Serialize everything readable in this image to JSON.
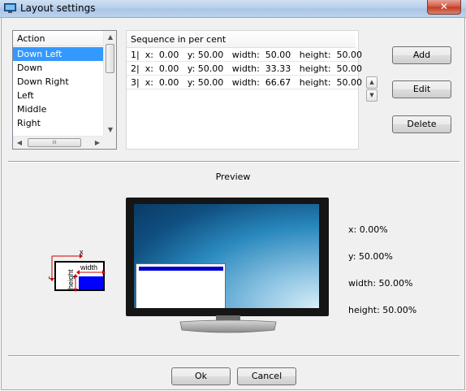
{
  "window": {
    "title": "Layout settings",
    "close_label": "✕"
  },
  "action_list": {
    "header": "Action",
    "items": [
      "Down Left",
      "Down",
      "Down Right",
      "Left",
      "Middle",
      "Right"
    ],
    "selected_index": 0,
    "hscroll_grip": "III"
  },
  "sequence": {
    "header": "Sequence in per cent",
    "rows": [
      "1|  x:  0.00   y: 50.00   width:  50.00   height:  50.00",
      "2|  x:  0.00   y: 50.00   width:  33.33   height:  50.00",
      "3|  x:  0.00   y: 50.00   width:  66.67   height:  50.00"
    ]
  },
  "buttons": {
    "add": "Add",
    "edit": "Edit",
    "delete": "Delete",
    "ok": "Ok",
    "cancel": "Cancel"
  },
  "preview": {
    "title": "Preview",
    "diagram_labels": {
      "x": "x",
      "y": "y",
      "width": "width",
      "height": "height"
    },
    "info": {
      "x": "x: 0.00%",
      "y": "y: 50.00%",
      "width": "width: 50.00%",
      "height": "height: 50.00%"
    }
  },
  "colors": {
    "selection": "#3399ff",
    "accent_blue": "#0000cc",
    "diagram_red": "#cc0000"
  }
}
